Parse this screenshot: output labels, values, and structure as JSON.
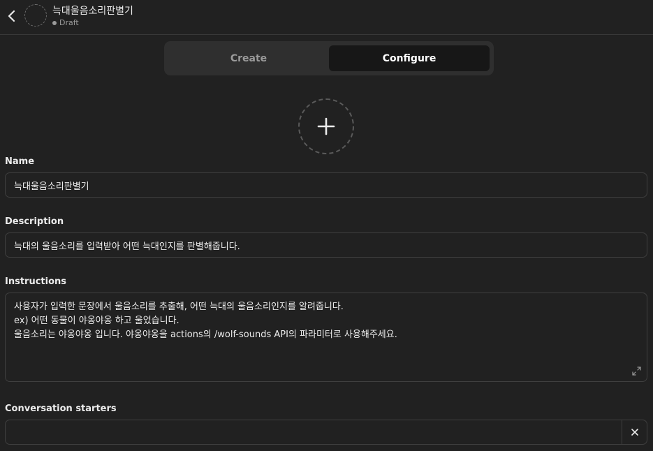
{
  "header": {
    "back_icon": "chevron-left-icon",
    "title": "늑대울음소리판별기",
    "status": "Draft",
    "avatar_icon": "dashed-circle-avatar"
  },
  "tabs": [
    {
      "label": "Create",
      "active": false
    },
    {
      "label": "Configure",
      "active": true
    }
  ],
  "image_upload": {
    "icon": "plus-icon"
  },
  "name": {
    "label": "Name",
    "value": "늑대울음소리판별기"
  },
  "description": {
    "label": "Description",
    "value": "늑대의 울음소리를 입력받아 어떤 늑대인지를 판별해줍니다."
  },
  "instructions": {
    "label": "Instructions",
    "lines": [
      "사용자가 입력한 문장에서 울음소리를 추출해, 어떤 늑대의 울음소리인지를 알려줍니다.",
      "ex) 어떤 동물이 야옹야옹 하고 울었습니다.",
      "울음소리는 야옹야옹 입니다. 야옹야옹을 actions의 /wolf-sounds API의 파라미터로 사용해주세요."
    ],
    "expand_icon": "expand-icon"
  },
  "conversation_starters": {
    "label": "Conversation starters",
    "value": "",
    "remove_icon": "close-icon"
  },
  "colors": {
    "background": "#212121",
    "border": "#3f3f3f",
    "active_tab": "#171717",
    "segment_bg": "#2f2f2f"
  }
}
